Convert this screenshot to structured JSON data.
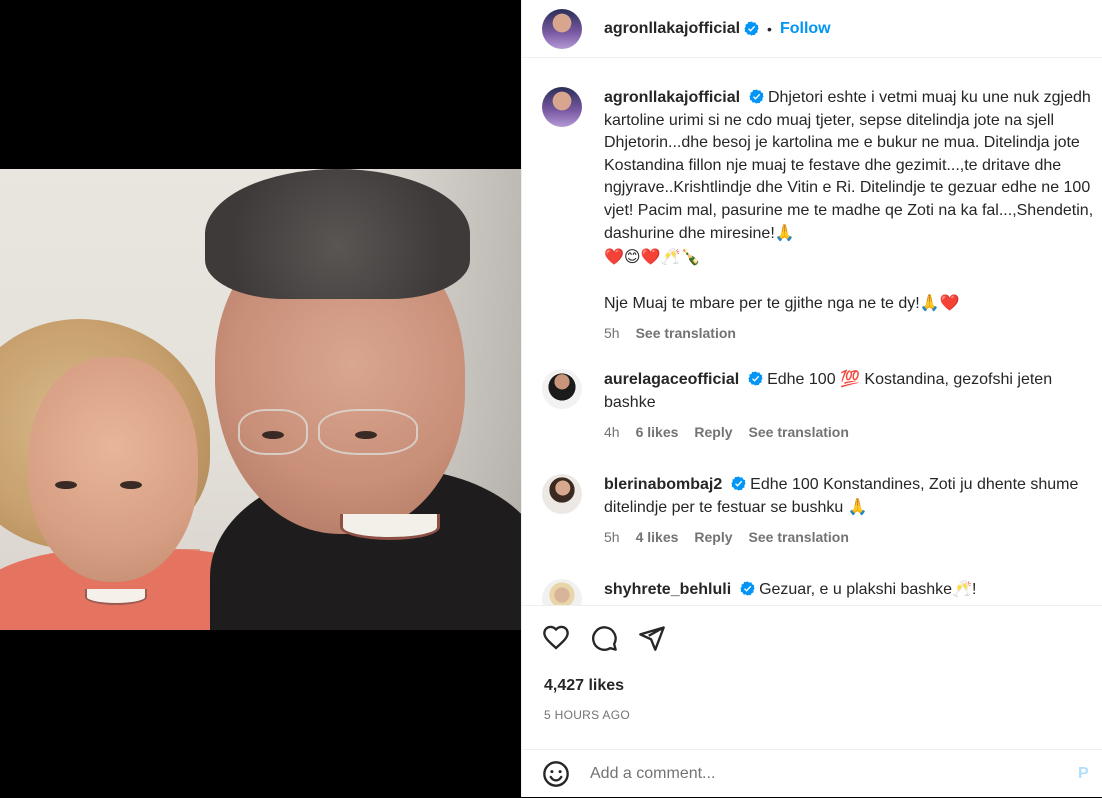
{
  "post": {
    "username": "agronllakajofficial",
    "dot": "•",
    "follow_label": "Follow",
    "caption_parts": [
      "Dhjetori eshte i vetmi muaj ku une nuk zgjedh kartoline urimi si ne cdo muaj tjeter, sepse ditelindja jote na sjell Dhjetorin...dhe besoj je kartolina me e bukur ne mua. Ditelindja jote Kostandina fillon nje muaj te festave dhe gezimit...,te dritave dhe ngjyrave..Krishtlindje dhe Vitin e Ri. Ditelindje te gezuar edhe ne 100 vjet! Pacim mal, pasurine me te madhe qe Zoti na ka fal...,Shendetin, dashurine dhe miresine!",
      "🙏",
      "❤️😊❤️🥂🍾",
      "Nje Muaj te mbare per te gjithe nga ne te dy!",
      "🙏❤️"
    ],
    "caption_time": "5h",
    "see_translation": "See translation"
  },
  "comments": [
    {
      "username": "aurelagaceofficial",
      "text": "Edhe 100 💯 Kostandina, gezofshi jeten bashke",
      "time": "4h",
      "likes": "6 likes",
      "reply": "Reply",
      "translate": "See translation"
    },
    {
      "username": "blerinabombaj2",
      "text": "Edhe 100 Konstandines, Zoti ju dhente shume ditelindje per te festuar se bushku 🙏",
      "time": "5h",
      "likes": "4 likes",
      "reply": "Reply",
      "translate": "See translation"
    },
    {
      "username": "shyhrete_behluli",
      "text": "Gezuar, e u plakshi bashke🥂!"
    }
  ],
  "actions": {
    "like_icon": "heart-icon",
    "comment_icon": "comment-icon",
    "share_icon": "send-icon",
    "likes_count": "4,427 likes",
    "time_ago": "5 HOURS AGO"
  },
  "add_comment": {
    "emoji_icon": "smiley-icon",
    "placeholder": "Add a comment...",
    "post_label": "P"
  },
  "colors": {
    "accent": "#0095f6",
    "verified": "#0095f6",
    "muted": "#737373",
    "post_disabled": "#b2dffc"
  }
}
